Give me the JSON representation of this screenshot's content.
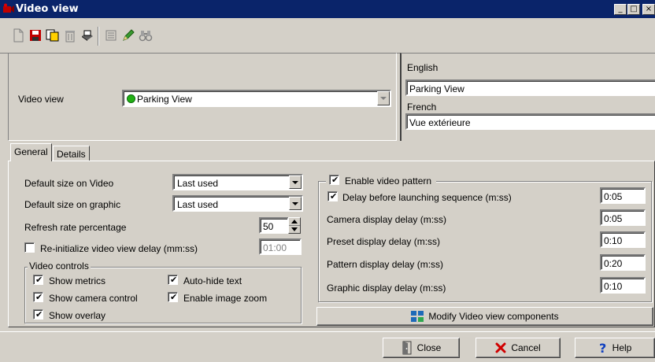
{
  "window": {
    "title": "Video view",
    "minimize": "_",
    "maximize": "□",
    "close": "×"
  },
  "toolbar": {
    "icons": [
      "new-icon",
      "save-icon",
      "copy-icon",
      "delete-icon",
      "print-icon",
      "list-icon",
      "edit-pen-icon",
      "find-binoculars-icon"
    ]
  },
  "header": {
    "video_view_label": "Video view",
    "video_view_value": "Parking View",
    "status_color": "#22b014",
    "lang1": "English",
    "lang1_value": "Parking View",
    "lang2": "French",
    "lang2_value": "Vue extérieure"
  },
  "tabs": [
    {
      "label": "General",
      "active": true
    },
    {
      "label": "Details",
      "active": false
    }
  ],
  "general": {
    "default_size_video_label": "Default size on Video",
    "default_size_video_value": "Last used",
    "default_size_graphic_label": "Default size on graphic",
    "default_size_graphic_value": "Last used",
    "refresh_rate_label": "Refresh rate percentage",
    "refresh_rate_value": "50",
    "reinit_label": "Re-initialize video view delay (mm:ss)",
    "reinit_checked": false,
    "reinit_value": "01:00",
    "video_controls": {
      "title": "Video controls",
      "show_metrics": "Show metrics",
      "show_camera_control": "Show camera control",
      "show_overlay": "Show overlay",
      "auto_hide_text": "Auto-hide text",
      "enable_image_zoom": "Enable image zoom",
      "check": "✔"
    },
    "pattern": {
      "enable_label": "Enable video pattern",
      "delay_label": "Delay before launching sequence (m:ss)",
      "delay_value": "0:05",
      "camera_label": "Camera display delay (m:ss)",
      "camera_value": "0:05",
      "preset_label": "Preset display delay (m:ss)",
      "preset_value": "0:10",
      "pattern_label": "Pattern display delay (m:ss)",
      "pattern_value": "0:20",
      "graphic_label": "Graphic display delay (m:ss)",
      "graphic_value": "0:10"
    },
    "modify_button": "Modify Video view components"
  },
  "footer": {
    "close": "Close",
    "cancel": "Cancel",
    "help": "Help"
  }
}
